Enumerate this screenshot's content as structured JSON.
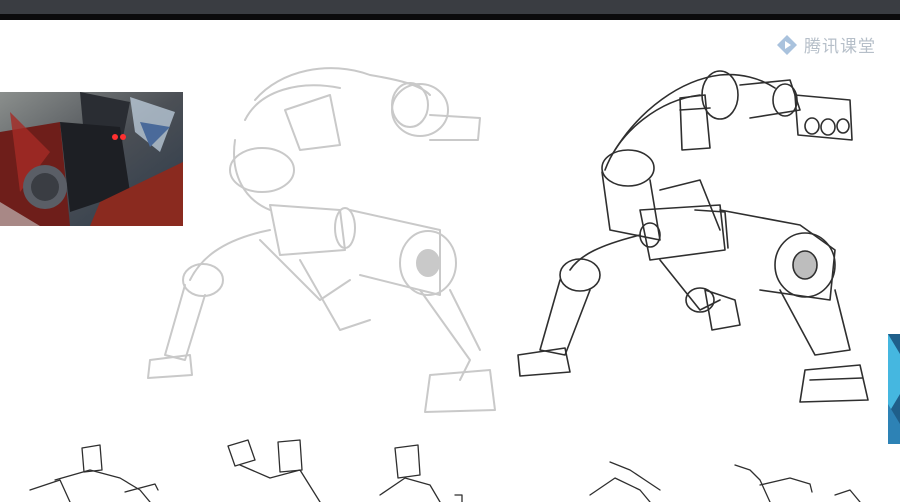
{
  "window": {
    "watermark_text": "腾讯课堂"
  },
  "colors": {
    "topbar": "#3a3d42",
    "canvas": "#ffffff",
    "sketch_dark": "#2a2a2a",
    "sketch_light": "#c9c9c9",
    "watermark": "#b6bfc9"
  },
  "icons": {
    "watermark": "tencent-classroom-logo-icon",
    "reference": "armored-knight-reference-image"
  }
}
